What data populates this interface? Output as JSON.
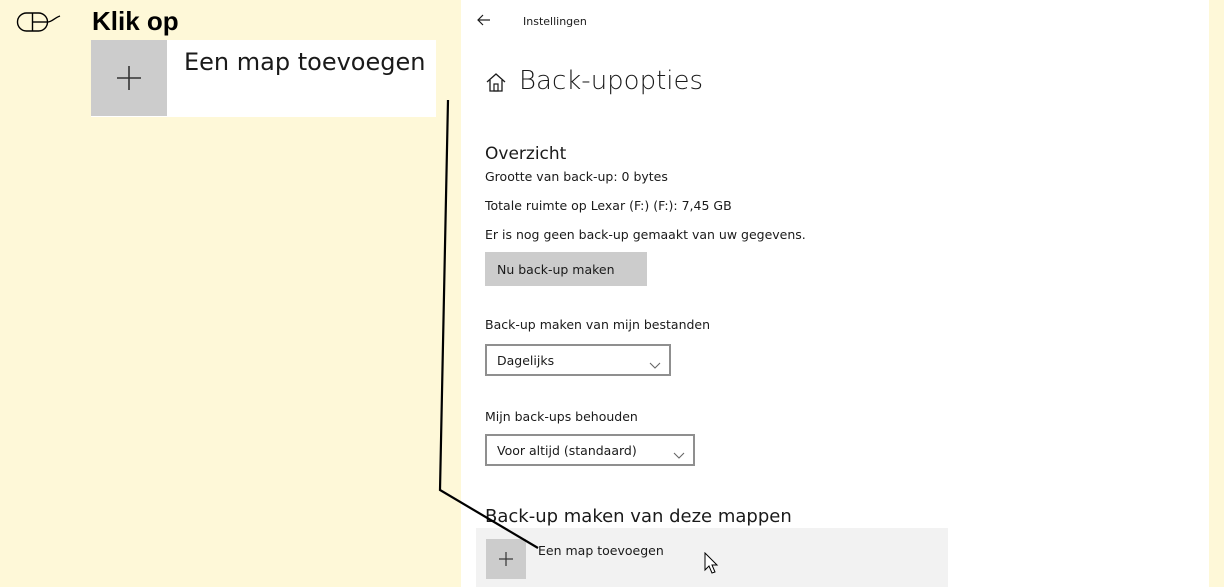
{
  "instruction": {
    "title": "Klik op",
    "icon": "mouse-icon",
    "example": {
      "label": "Een map toevoegen",
      "icon": "plus-icon"
    }
  },
  "window": {
    "title": "Instellingen",
    "back_icon": "back-arrow-icon"
  },
  "page": {
    "title": "Back-upopties",
    "icon": "home-icon"
  },
  "overview": {
    "heading": "Overzicht",
    "backup_size": "Grootte van back-up: 0 bytes",
    "total_space": "Totale ruimte op Lexar (F:) (F:): 7,45 GB",
    "status": "Er is nog geen back-up gemaakt van uw gegevens.",
    "backup_now_button": "Nu back-up maken"
  },
  "frequency": {
    "label": "Back-up maken van mijn bestanden",
    "selected": "Dagelijks"
  },
  "retention": {
    "label": "Mijn back-ups behouden",
    "selected": "Voor altijd (standaard)"
  },
  "folders": {
    "heading": "Back-up maken van deze mappen",
    "add_label": "Een map toevoegen"
  },
  "colors": {
    "page_background": "#fef8d8",
    "button_gray": "#cccccc",
    "row_gray": "#f2f2f2",
    "window_background": "#ffffff"
  }
}
